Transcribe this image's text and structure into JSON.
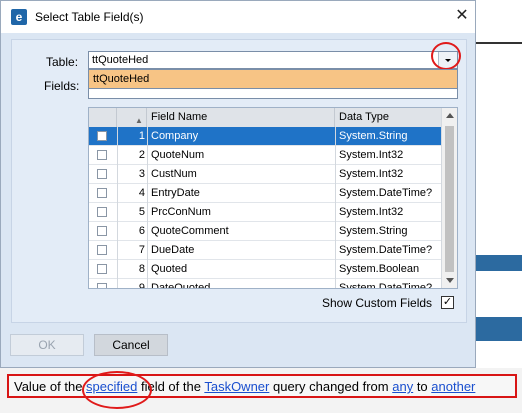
{
  "dialog": {
    "title": "Select Table Field(s)",
    "close_label": "✕",
    "app_icon_glyph": "e"
  },
  "form": {
    "table_label": "Table:",
    "fields_label": "Fields:",
    "table_value": "ttQuoteHed",
    "dropdown_options": [
      "ttQuoteHed"
    ]
  },
  "grid": {
    "columns": [
      "",
      "",
      "Field Name",
      "Data Type"
    ],
    "rows": [
      {
        "num": "1",
        "field": "Company",
        "type": "System.String",
        "selected": true
      },
      {
        "num": "2",
        "field": "QuoteNum",
        "type": "System.Int32"
      },
      {
        "num": "3",
        "field": "CustNum",
        "type": "System.Int32"
      },
      {
        "num": "4",
        "field": "EntryDate",
        "type": "System.DateTime?"
      },
      {
        "num": "5",
        "field": "PrcConNum",
        "type": "System.Int32"
      },
      {
        "num": "6",
        "field": "QuoteComment",
        "type": "System.String"
      },
      {
        "num": "7",
        "field": "DueDate",
        "type": "System.DateTime?"
      },
      {
        "num": "8",
        "field": "Quoted",
        "type": "System.Boolean"
      },
      {
        "num": "9",
        "field": "DateQuoted",
        "type": "System.DateTime?"
      }
    ]
  },
  "options": {
    "show_custom_label": "Show Custom Fields",
    "show_custom_checked": true,
    "check_glyph": "✓"
  },
  "buttons": {
    "ok": "OK",
    "cancel": "Cancel"
  },
  "message": {
    "part1": "Value of the ",
    "link1": "specified",
    "part2": " field of the ",
    "link2": "TaskOwner",
    "part3": " query changed from ",
    "link3": "any",
    "part4": " to ",
    "link4": "another"
  },
  "colors": {
    "selection": "#1f73c7",
    "dropdown_highlight": "#f7c485",
    "annotation_red": "#e01a1a",
    "link": "#1a4fcf"
  }
}
